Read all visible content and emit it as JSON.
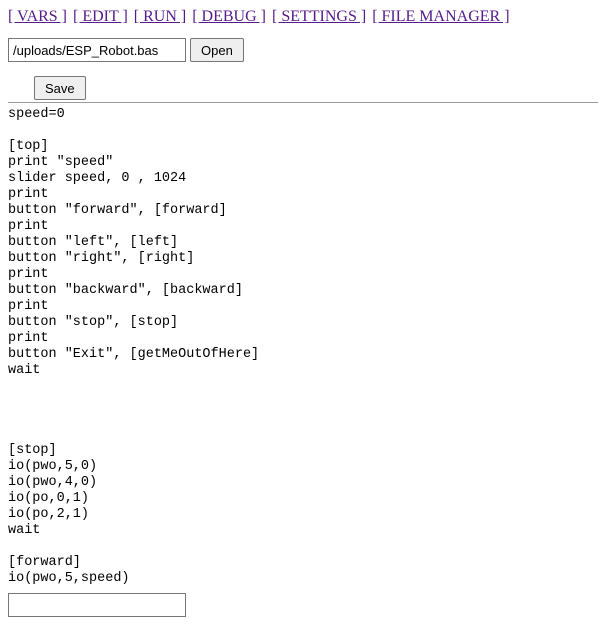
{
  "nav": {
    "vars": "[ VARS ]",
    "edit": "[ EDIT ]",
    "run": "[ RUN ]",
    "debug": "[ DEBUG ]",
    "settings": "[ SETTINGS ]",
    "fileManager": "[ FILE MANAGER ]"
  },
  "fileRow": {
    "path": "/uploads/ESP_Robot.bas",
    "openLabel": "Open"
  },
  "saveLabel": "Save",
  "code": "speed=0\n\n[top]\nprint \"speed\"\nslider speed, 0 , 1024\nprint\nbutton \"forward\", [forward]\nprint\nbutton \"left\", [left]\nbutton \"right\", [right]\nprint\nbutton \"backward\", [backward]\nprint\nbutton \"stop\", [stop]\nprint\nbutton \"Exit\", [getMeOutOfHere]\nwait\n\n\n\n\n[stop]\nio(pwo,5,0)\nio(pwo,4,0)\nio(po,0,1)\nio(po,2,1)\nwait\n\n[forward]\nio(pwo,5,speed)",
  "bottomInput": ""
}
